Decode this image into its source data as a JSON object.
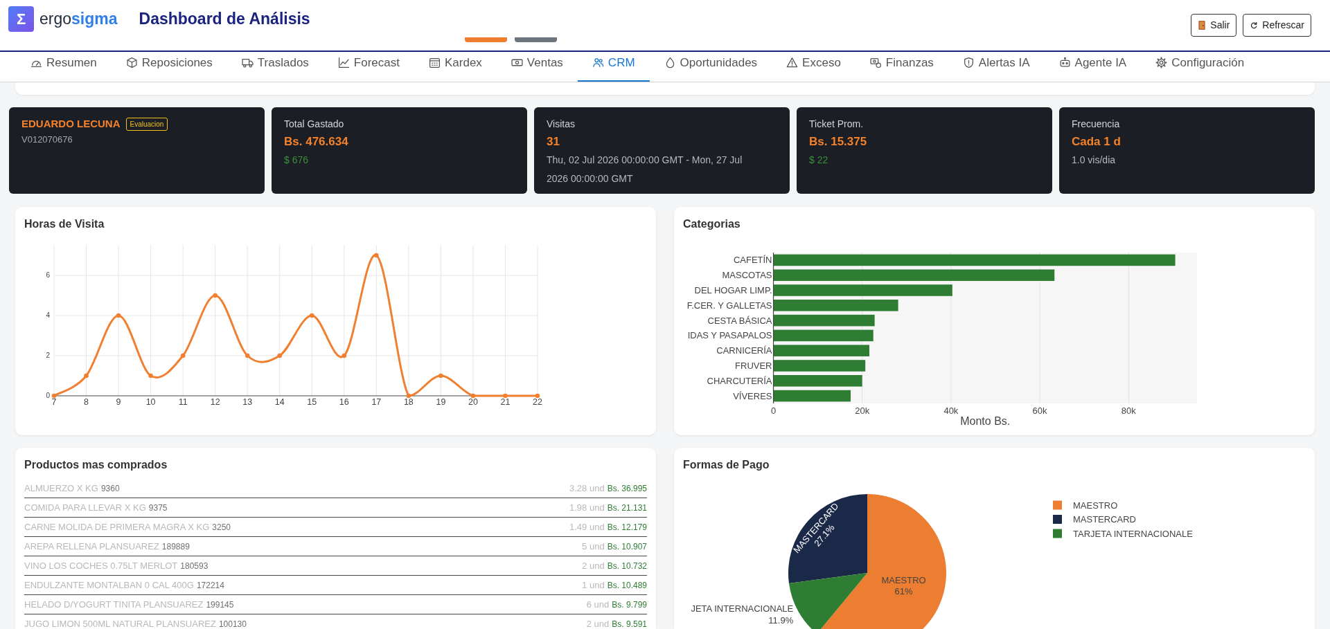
{
  "header": {
    "logo_symbol": "Σ",
    "brand": "ergo**sigma**",
    "title": "Dashboard de Análisis",
    "clipped_buttons": [
      {
        "color": "#ef7d2d"
      },
      {
        "color": "#6c757d"
      }
    ],
    "buttons": [
      {
        "kind": "exit",
        "label": "Salir"
      },
      {
        "kind": "refresh",
        "label": "Refrescar"
      }
    ]
  },
  "tabs": [
    {
      "label": "Resumen",
      "selected": false
    },
    {
      "label": "Reposiciones",
      "selected": false
    },
    {
      "label": "Traslados",
      "selected": false
    },
    {
      "label": "Forecast",
      "selected": false
    },
    {
      "label": "Kardex",
      "selected": false
    },
    {
      "label": "Ventas",
      "selected": false
    },
    {
      "label": "CRM",
      "selected": true
    },
    {
      "label": "Oportunidades",
      "selected": false
    },
    {
      "label": "Exceso",
      "selected": false
    },
    {
      "label": "Finanzas",
      "selected": false
    },
    {
      "label": "Alertas IA",
      "selected": false
    },
    {
      "label": "Agente IA",
      "selected": false
    },
    {
      "label": "Configuración",
      "selected": false
    }
  ],
  "summary_cards": [
    {
      "kind": "customer",
      "name": "EDUARDO LECUNA",
      "badge": "Evaluacion",
      "id": "V012070676"
    },
    {
      "kind": "metric",
      "label": "Total Gastado",
      "value": "Bs. 476.634",
      "note": {
        "kind": "usd",
        "text": "$ 676"
      }
    },
    {
      "kind": "metric",
      "label": "Visitas",
      "value": "31",
      "note": {
        "kind": "range",
        "text": "Thu, 02 Jul 2026 00:00:00 GMT - Mon, 27 Jul 2026 00:00:00 GMT"
      }
    },
    {
      "kind": "metric",
      "label": "Ticket Prom.",
      "value": "Bs. 15.375",
      "note": {
        "kind": "usd",
        "text": "$ 22"
      }
    },
    {
      "kind": "metric",
      "label": "Frecuencia",
      "value": "Cada 1 d",
      "note": {
        "kind": "plain",
        "text": "1.0 vis/dia"
      }
    }
  ],
  "visit_hours": {
    "title": "Horas de Visita",
    "chart_data": {
      "type": "line",
      "x": [
        7,
        8,
        9,
        10,
        11,
        12,
        13,
        14,
        15,
        16,
        17,
        18,
        19,
        20,
        21,
        22
      ],
      "series": [
        {
          "color": "#f07f2f",
          "marker": true,
          "values": [
            0,
            1,
            4,
            1,
            2,
            5,
            2,
            2,
            4,
            2,
            7,
            0,
            1,
            0,
            0,
            0
          ]
        }
      ],
      "xlim": [
        7,
        22
      ],
      "ylim": [
        0,
        7.5
      ],
      "xticks": [
        7,
        8,
        9,
        10,
        11,
        12,
        13,
        14,
        15,
        16,
        17,
        18,
        19,
        20,
        21,
        22
      ],
      "yticks": [
        0,
        2,
        4,
        6
      ],
      "grid": true
    }
  },
  "categories": {
    "title": "Categorias",
    "chart_data": {
      "type": "bar",
      "orientation": "horizontal",
      "categories": [
        "CAFETÍN",
        "MASCOTAS",
        "DEL HOGAR LIMP.",
        "F.CER. Y GALLETAS",
        "CESTA BÁSICA",
        "IDAS Y PASAPALOS",
        "CARNICERÍA",
        "FRUVER",
        "CHARCUTERÍA",
        "VÍVERES"
      ],
      "series": [
        {
          "color": "#2e7d32",
          "values": [
            90500,
            63300,
            40300,
            28100,
            22800,
            22500,
            21600,
            20700,
            20000,
            17400
          ]
        }
      ],
      "xlabel": "Monto Bs.",
      "xlim": [
        0,
        95400
      ],
      "xticks": [
        {
          "value": 0,
          "label": "0"
        },
        {
          "value": 20000,
          "label": "20k"
        },
        {
          "value": 40000,
          "label": "40k"
        },
        {
          "value": 60000,
          "label": "60k"
        },
        {
          "value": 80000,
          "label": "80k"
        }
      ],
      "grid": true
    }
  },
  "top_products": {
    "title": "Productos mas comprados",
    "rows": [
      {
        "name": "ALMUERZO X KG",
        "code": "9360",
        "quantity": "3.28 und",
        "amount": "Bs. 36.995"
      },
      {
        "name": "COMIDA PARA LLEVAR X KG",
        "code": "9375",
        "quantity": "1.98 und",
        "amount": "Bs. 21.131"
      },
      {
        "name": "CARNE MOLIDA DE PRIMERA MAGRA X KG",
        "code": "3250",
        "quantity": "1.49 und",
        "amount": "Bs. 12.179"
      },
      {
        "name": "AREPA RELLENA PLANSUAREZ",
        "code": "189889",
        "quantity": "5 und",
        "amount": "Bs. 10.907"
      },
      {
        "name": "VINO LOS COCHES 0.75LT MERLOT",
        "code": "180593",
        "quantity": "2 und",
        "amount": "Bs. 10.732"
      },
      {
        "name": "ENDULZANTE MONTALBAN 0 CAL 400G",
        "code": "172214",
        "quantity": "1 und",
        "amount": "Bs. 10.489"
      },
      {
        "name": "HELADO D/YOGURT TINITA PLANSUAREZ",
        "code": "199145",
        "quantity": "6 und",
        "amount": "Bs. 9.799"
      },
      {
        "name": "JUGO LIMON 500ML NATURAL PLANSUAREZ",
        "code": "100130",
        "quantity": "2 und",
        "amount": "Bs. 9.591"
      }
    ]
  },
  "payment_methods": {
    "title": "Formas de Pago",
    "chart_data": {
      "type": "pie",
      "categories": [
        "MAESTRO",
        "MASTERCARD",
        "TARJETA INTERNACIONALE"
      ],
      "values": [
        61,
        27.1,
        11.9
      ],
      "colors": [
        "#ed7d31",
        "#1b2949",
        "#2e7d32"
      ],
      "data_labels": true,
      "value_labels": [
        "61%",
        "27.1%",
        "11.9%"
      ],
      "legend": "right"
    },
    "slice_names": [
      "MAESTRO",
      "MASTERCARD",
      "JETA INTERNACIONALE"
    ]
  }
}
